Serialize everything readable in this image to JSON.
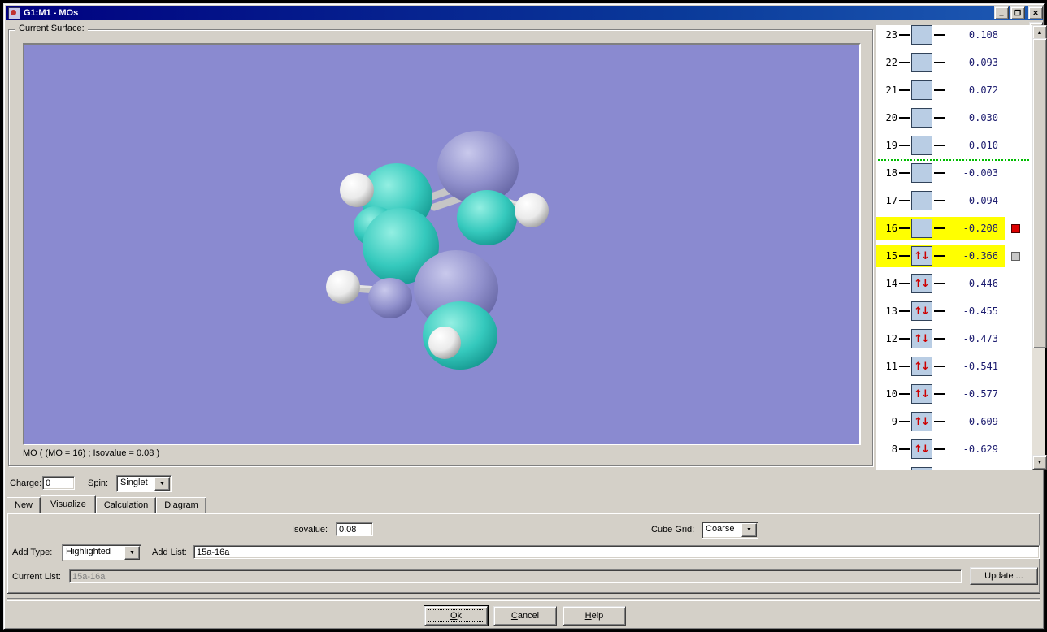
{
  "window": {
    "title": "G1:M1 - MOs",
    "minimize": "_",
    "restore": "❐",
    "close": "✕",
    "mdi_restore": "▬"
  },
  "surface": {
    "group_label": "Current Surface:",
    "caption": "MO ( (MO = 16) ; Isovalue = 0.08 )",
    "background_color": "#8a8ad0",
    "positive_lobe_color": "#9090cc",
    "negative_lobe_color": "#35c9bd"
  },
  "mo_list": {
    "highlight_color": "#ffff00",
    "divider_color": "#00bb00",
    "divider_after": "19",
    "rows": [
      {
        "n": "23",
        "value": "0.108",
        "occupied": false,
        "highlight": false,
        "marker": null
      },
      {
        "n": "22",
        "value": "0.093",
        "occupied": false,
        "highlight": false,
        "marker": null
      },
      {
        "n": "21",
        "value": "0.072",
        "occupied": false,
        "highlight": false,
        "marker": null
      },
      {
        "n": "20",
        "value": "0.030",
        "occupied": false,
        "highlight": false,
        "marker": null
      },
      {
        "n": "19",
        "value": "0.010",
        "occupied": false,
        "highlight": false,
        "marker": null
      },
      {
        "n": "18",
        "value": "-0.003",
        "occupied": false,
        "highlight": false,
        "marker": null
      },
      {
        "n": "17",
        "value": "-0.094",
        "occupied": false,
        "highlight": false,
        "marker": null
      },
      {
        "n": "16",
        "value": "-0.208",
        "occupied": false,
        "highlight": true,
        "marker": "red"
      },
      {
        "n": "15",
        "value": "-0.366",
        "occupied": true,
        "highlight": true,
        "marker": "gray"
      },
      {
        "n": "14",
        "value": "-0.446",
        "occupied": true,
        "highlight": false,
        "marker": null
      },
      {
        "n": "13",
        "value": "-0.455",
        "occupied": true,
        "highlight": false,
        "marker": null
      },
      {
        "n": "12",
        "value": "-0.473",
        "occupied": true,
        "highlight": false,
        "marker": null
      },
      {
        "n": "11",
        "value": "-0.541",
        "occupied": true,
        "highlight": false,
        "marker": null
      },
      {
        "n": "10",
        "value": "-0.577",
        "occupied": true,
        "highlight": false,
        "marker": null
      },
      {
        "n": "9",
        "value": "-0.609",
        "occupied": true,
        "highlight": false,
        "marker": null
      },
      {
        "n": "8",
        "value": "-0.629",
        "occupied": true,
        "highlight": false,
        "marker": null
      },
      {
        "n": "",
        "value": "",
        "occupied": true,
        "highlight": false,
        "marker": null
      }
    ]
  },
  "charge_spin": {
    "charge_label": "Charge:",
    "charge_value": "0",
    "spin_label": "Spin:",
    "spin_value": "Singlet"
  },
  "tabs": {
    "items": [
      {
        "label": "New"
      },
      {
        "label": "Visualize"
      },
      {
        "label": "Calculation"
      },
      {
        "label": "Diagram"
      }
    ]
  },
  "visualize": {
    "isovalue_label": "Isovalue:",
    "isovalue_value": "0.08",
    "cube_grid_label": "Cube Grid:",
    "cube_grid_value": "Coarse",
    "add_type_label": "Add Type:",
    "add_type_value": "Highlighted",
    "add_list_label": "Add List:",
    "add_list_value": "15a-16a",
    "current_list_label": "Current List:",
    "current_list_value": "15a-16a",
    "update_label": "Update ..."
  },
  "footer": {
    "ok": "Ok",
    "cancel": "Cancel",
    "help": "Help"
  }
}
